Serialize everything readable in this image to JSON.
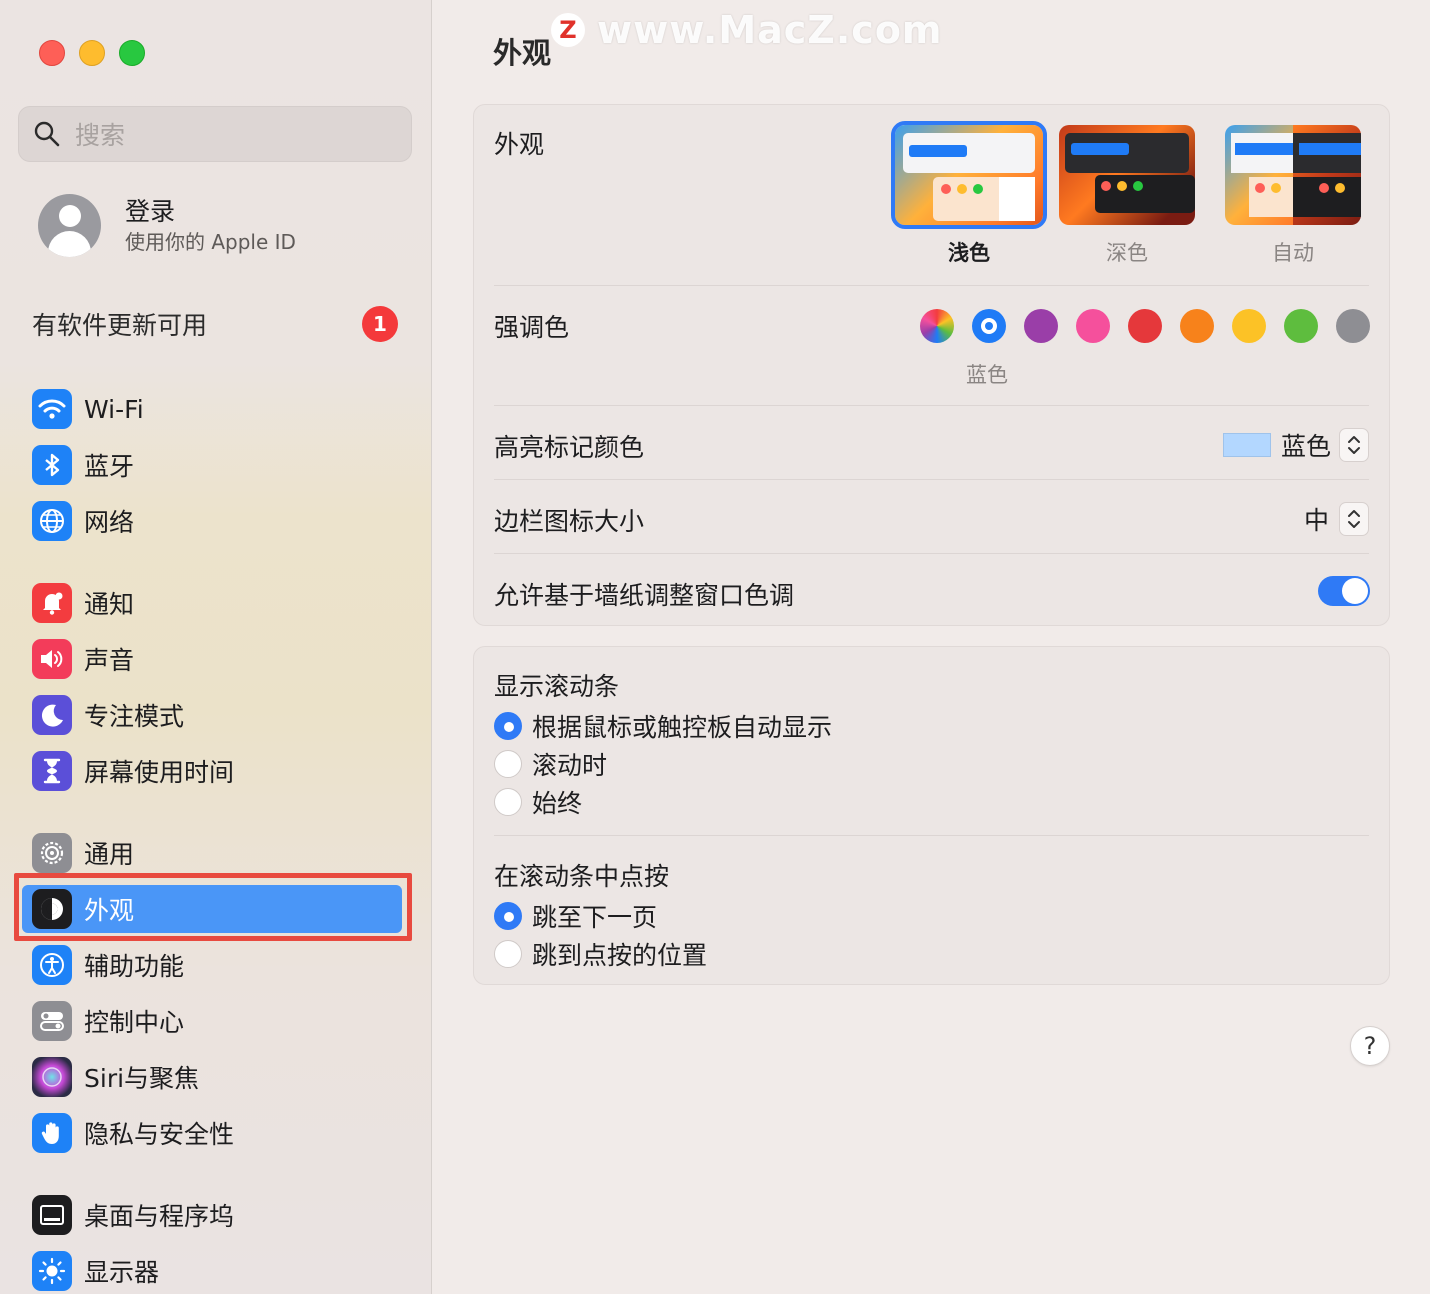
{
  "window": {
    "title": "外观"
  },
  "watermark": {
    "logo": "Z",
    "text": "www.MacZ.com"
  },
  "sidebar": {
    "search_placeholder": "搜索",
    "account": {
      "title": "登录",
      "subtitle": "使用你的 Apple ID"
    },
    "update": {
      "label": "有软件更新可用",
      "badge": "1"
    },
    "items": [
      {
        "label": "Wi-Fi",
        "icon": "wifi-icon",
        "color": "#1e82f7"
      },
      {
        "label": "蓝牙",
        "icon": "bluetooth-icon",
        "color": "#1e82f7"
      },
      {
        "label": "网络",
        "icon": "globe-icon",
        "color": "#1e82f7"
      },
      {
        "label": "通知",
        "icon": "bell-icon",
        "color": "#f33c3f"
      },
      {
        "label": "声音",
        "icon": "speaker-icon",
        "color": "#f33c5a"
      },
      {
        "label": "专注模式",
        "icon": "moon-icon",
        "color": "#5b4fd8"
      },
      {
        "label": "屏幕使用时间",
        "icon": "hourglass-icon",
        "color": "#5b4fd8"
      },
      {
        "label": "通用",
        "icon": "gear-icon",
        "color": "#8e8e93"
      },
      {
        "label": "外观",
        "icon": "appearance-icon",
        "color": "#1d1d1f",
        "selected": true
      },
      {
        "label": "辅助功能",
        "icon": "accessibility-icon",
        "color": "#1e82f7"
      },
      {
        "label": "控制中心",
        "icon": "switches-icon",
        "color": "#8e8e93"
      },
      {
        "label": "Siri与聚焦",
        "icon": "siri-icon",
        "color": "#2a2a3a"
      },
      {
        "label": "隐私与安全性",
        "icon": "hand-icon",
        "color": "#1e82f7"
      },
      {
        "label": "桌面与程序坞",
        "icon": "dock-icon",
        "color": "#1d1d1f"
      },
      {
        "label": "显示器",
        "icon": "sun-icon",
        "color": "#1e82f7"
      }
    ]
  },
  "main": {
    "appearance": {
      "label": "外观",
      "options": [
        {
          "label": "浅色",
          "selected": true
        },
        {
          "label": "深色",
          "selected": false
        },
        {
          "label": "自动",
          "selected": false
        }
      ]
    },
    "accent": {
      "label": "强调色",
      "selected_caption": "蓝色",
      "colors": [
        "multicolor",
        "#1f7bf6",
        "#9a3ea8",
        "#f5509c",
        "#e5383b",
        "#f7821b",
        "#fcc226",
        "#5ebd3e",
        "#8e8e93"
      ]
    },
    "highlight": {
      "label": "高亮标记颜色",
      "value": "蓝色",
      "swatch": "#b3d7ff"
    },
    "sidebar_icon_size": {
      "label": "边栏图标大小",
      "value": "中"
    },
    "wallpaper_tinting": {
      "label": "允许基于墙纸调整窗口色调",
      "on": true
    },
    "scrollbars": {
      "label": "显示滚动条",
      "options": [
        {
          "label": "根据鼠标或触控板自动显示",
          "selected": true
        },
        {
          "label": "滚动时",
          "selected": false
        },
        {
          "label": "始终",
          "selected": false
        }
      ]
    },
    "click_scrollbar": {
      "label": "在滚动条中点按",
      "options": [
        {
          "label": "跳至下一页",
          "selected": true
        },
        {
          "label": "跳到点按的位置",
          "selected": false
        }
      ]
    },
    "help_label": "?"
  }
}
